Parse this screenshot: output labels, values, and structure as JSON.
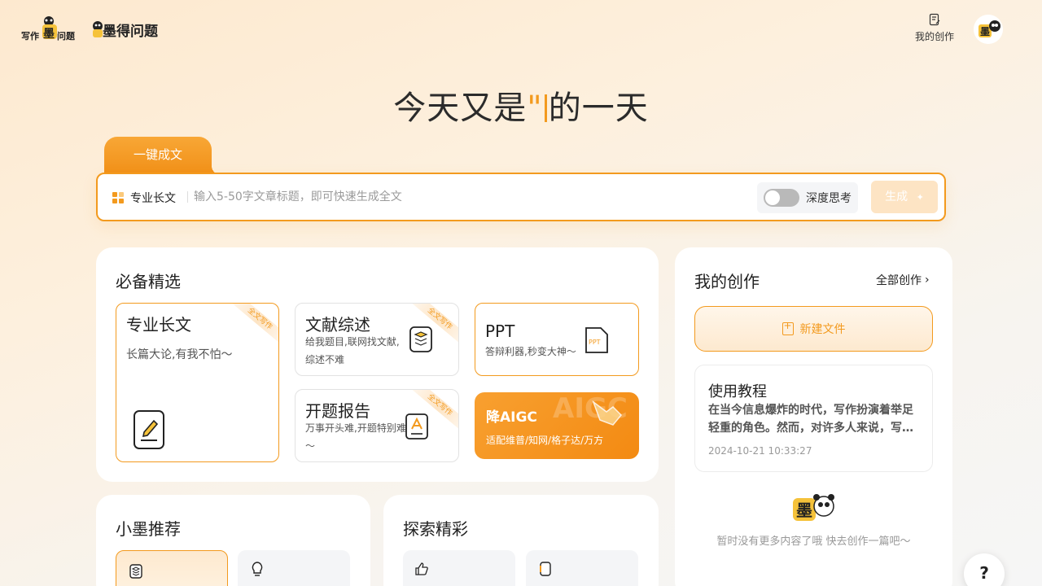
{
  "header": {
    "logo1_text": "写作墨问题",
    "logo2_text": "墨得问题",
    "my_creation_label": "我的创作"
  },
  "hero": {
    "before": "今天又是",
    "quote": "\"",
    "after": "的一天"
  },
  "composer": {
    "tab_label": "一键成文",
    "mode_label": "专业长文",
    "placeholder": "输入5-50字文章标题，即可快速生成全文",
    "deep_think_label": "深度思考",
    "deep_think_on": false,
    "generate_label": "生成"
  },
  "essentials": {
    "title": "必备精选",
    "items": [
      {
        "title": "专业长文",
        "desc": "长篇大论,有我不怕～",
        "ribbon": "全文写作"
      },
      {
        "title": "文献综述",
        "desc": "给我题目,联网找文献,综述不难",
        "ribbon": "全文写作"
      },
      {
        "title": "PPT",
        "desc": "答辩利器,秒变大神～",
        "icon_text": "PPT"
      },
      {
        "title": "开题报告",
        "desc": "万事开头难,开题特别难～",
        "ribbon": "全文写作"
      },
      {
        "title": "降AIGC",
        "desc": "适配维普/知网/格子达/万方",
        "bg_text": "AIGC"
      }
    ]
  },
  "my_creation": {
    "title": "我的创作",
    "all_label": "全部创作",
    "new_file_label": "新建文件",
    "tutorial": {
      "title": "使用教程",
      "body": "在当今信息爆炸的时代，写作扮演着举足轻重的角色。然而，对许多人来说，写…",
      "time": "2024-10-21 10:33:27"
    },
    "empty_text": "暂时没有更多内容了哦 快去创作一篇吧～"
  },
  "recommend": {
    "title": "小墨推荐"
  },
  "explore": {
    "title": "探索精彩"
  },
  "help": {
    "label": "?"
  },
  "colors": {
    "accent": "#f39a1e"
  }
}
